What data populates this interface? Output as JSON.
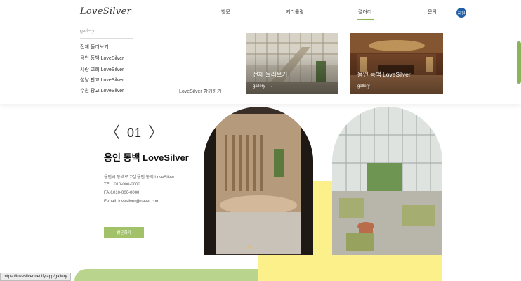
{
  "header": {
    "logo": "LoveSilver",
    "nav": [
      "방문",
      "커리큘럼",
      "갤러리",
      "문의"
    ],
    "lang": "지원"
  },
  "mega_menu": {
    "heading": "gallery",
    "links": [
      "전체 둘러보기",
      "용인 동백 LoveSilver",
      "사랑 교회 LoveSilver",
      "성남 판교 LoveSilver",
      "수원 광교 LoveSilver"
    ],
    "footer": "LoveSilver 함께하기",
    "cards": [
      {
        "title": "전체 둘러보기",
        "link": "gallery"
      },
      {
        "title": "용인 동백 LoveSilver",
        "link": "gallery"
      }
    ]
  },
  "main": {
    "prev": "〈",
    "index": "01",
    "next": "〉",
    "title": "용인 동백 LoveSilver",
    "address": "용인시 동백로 7길 용인 동백 LoveSilver",
    "tel": "TEL. 010-000-0000",
    "fax": "FAX.010-000-0000",
    "email": "E-mail. lovesilver@naver.com",
    "button": "방문하기"
  },
  "status_bar": {
    "url": "https://lovesilver.netlify.app/gallery"
  },
  "colors": {
    "accent_green": "#a2c26a",
    "accent_yellow": "#fbf08a",
    "lang_blue": "#1f5fa8"
  }
}
